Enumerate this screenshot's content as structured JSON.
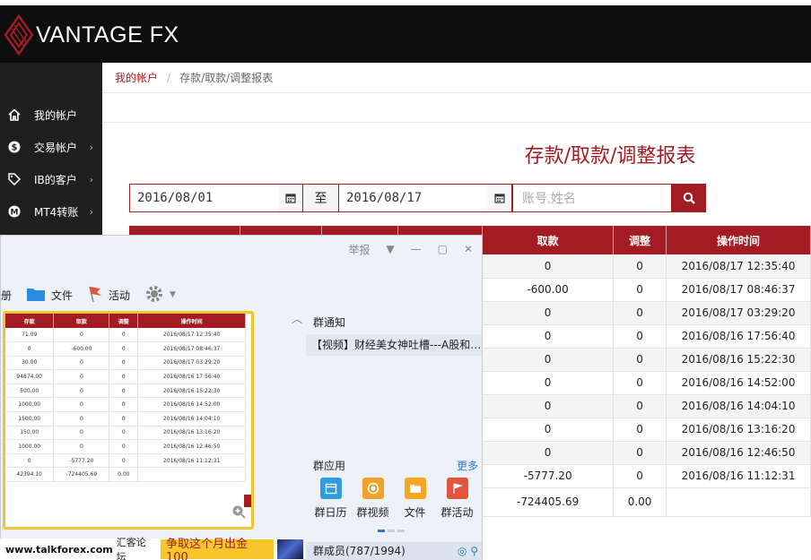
{
  "brand": {
    "name": "VANTAGE FX"
  },
  "sidebar": {
    "items": [
      {
        "label": "我的帐户",
        "icon": "home-icon",
        "has_submenu": false
      },
      {
        "label": "交易帐户",
        "icon": "dollar-icon",
        "has_submenu": true
      },
      {
        "label": "IB的客户",
        "icon": "tag-icon",
        "has_submenu": true
      },
      {
        "label": "MT4转账",
        "icon": "m-circle-icon",
        "has_submenu": true
      }
    ]
  },
  "breadcrumb": {
    "home": "我的帐户",
    "separator": "/",
    "current": "存款/取款/调整报表"
  },
  "page_title": "存款/取款/调整报表",
  "filters": {
    "start_date": "2016/08/01",
    "to_label": "至",
    "end_date": "2016/08/17",
    "search_placeholder": "账号,姓名"
  },
  "report": {
    "visible_headers": [
      "取款",
      "调整",
      "操作时间"
    ],
    "rows": [
      [
        "0",
        "0",
        "2016/08/17 12:35:40"
      ],
      [
        "-600.00",
        "0",
        "2016/08/17 08:46:37"
      ],
      [
        "0",
        "0",
        "2016/08/17 03:29:20"
      ],
      [
        "0",
        "0",
        "2016/08/16 17:56:40"
      ],
      [
        "0",
        "0",
        "2016/08/16 15:22:30"
      ],
      [
        "0",
        "0",
        "2016/08/16 14:52:00"
      ],
      [
        "0",
        "0",
        "2016/08/16 14:04:10"
      ],
      [
        "0",
        "0",
        "2016/08/16 13:16:20"
      ],
      [
        "0",
        "0",
        "2016/08/16 12:46:50"
      ],
      [
        "-5777.20",
        "0",
        "2016/08/16 11:12:31"
      ]
    ],
    "total": [
      "-724405.69",
      "0.00",
      ""
    ]
  },
  "chat": {
    "title_actions": [
      "举报"
    ],
    "toolbar": [
      {
        "label": "册",
        "icon": "album-icon"
      },
      {
        "label": "文件",
        "icon": "folder-icon"
      },
      {
        "label": "活动",
        "icon": "flag-icon"
      }
    ],
    "screenshot": {
      "headers": [
        "存款",
        "取款",
        "调整",
        "操作时间"
      ],
      "rows": [
        [
          "71.09",
          "0",
          "0",
          "2016/08/17 12:35:40"
        ],
        [
          "0",
          "-600.00",
          "0",
          "2016/08/17 08:46:37"
        ],
        [
          "30.00",
          "0",
          "0",
          "2016/08/17 03:29:20"
        ],
        [
          "94874.00",
          "0",
          "0",
          "2016/08/16 17:56:40"
        ],
        [
          "500.00",
          "0",
          "0",
          "2016/08/16 15:22:30"
        ],
        [
          "1000.00",
          "0",
          "0",
          "2016/08/16 14:52:00"
        ],
        [
          "1500.00",
          "0",
          "0",
          "2016/08/16 14:04:10"
        ],
        [
          "150.00",
          "0",
          "0",
          "2016/08/16 13:16:20"
        ],
        [
          "1000.00",
          "0",
          "0",
          "2016/08/16 12:46:50"
        ],
        [
          "0",
          "-5777.20",
          "0",
          "2016/08/16 11:12:31"
        ]
      ],
      "total": [
        "42394.10",
        "-724405.69",
        "0.00",
        ""
      ]
    },
    "notice": {
      "heading": "群通知",
      "item": "【视频】财经美女神吐槽---A股和…"
    },
    "apps": {
      "heading": "群应用",
      "more": "更多",
      "items": [
        {
          "label": "群日历",
          "icon": "calendar-icon",
          "color": "#2f9be3"
        },
        {
          "label": "群视频",
          "icon": "video-icon",
          "color": "#f0a12a"
        },
        {
          "label": "文件",
          "icon": "folder-icon",
          "color": "#f5a623"
        },
        {
          "label": "群活动",
          "icon": "event-icon",
          "color": "#e2553a"
        }
      ]
    },
    "members": "群成员(787/1994)"
  },
  "footer": {
    "url": "www.talkforex.com",
    "site_name": "汇客论坛",
    "promo": "争取这个月出金100"
  },
  "colors": {
    "accent": "#a31c24",
    "header_bg": "#0e0e0e",
    "sidebar_bg": "#1f1f1f",
    "link_blue": "#2a7ad5"
  }
}
